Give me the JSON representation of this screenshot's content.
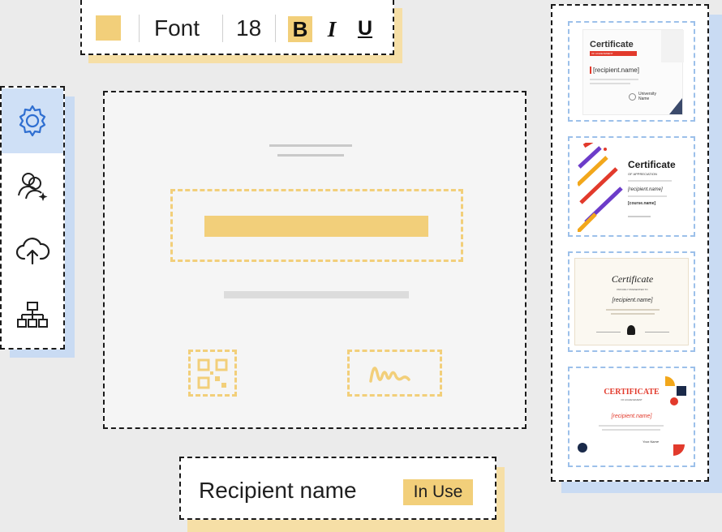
{
  "toolbar": {
    "font_label": "Font",
    "font_size": "18",
    "bold_label": "B",
    "italic_label": "I",
    "underline_label": "U",
    "swatch_color": "#f2cf7a"
  },
  "sidebar": {
    "items": [
      {
        "icon": "gear-icon",
        "active": true
      },
      {
        "icon": "users-sparkle-icon",
        "active": false
      },
      {
        "icon": "cloud-upload-icon",
        "active": false
      },
      {
        "icon": "sitemap-icon",
        "active": false
      }
    ]
  },
  "recipient_bar": {
    "label": "Recipient name",
    "status": "In Use"
  },
  "templates": [
    {
      "title": "Certificate",
      "subtitle": "OF ACHIEVEMENT",
      "field": "[recipient.name]",
      "org": "University Name"
    },
    {
      "title": "Certificate",
      "subtitle": "OF APPRECIATION",
      "field": "[recipient.name]",
      "sub_field": "[course.name]"
    },
    {
      "title": "Certificate",
      "subtitle": "PROUDLY PRESENTED TO",
      "field": "[recipient.name]"
    },
    {
      "title": "CERTIFICATE",
      "subtitle": "OF ACHIEVEMENT",
      "field": "[recipient.name]",
      "sign": "Your Name"
    }
  ],
  "colors": {
    "accent_yellow": "#f2cf7a",
    "accent_blue": "#cfe0f6",
    "cert_red": "#e23a2c"
  }
}
